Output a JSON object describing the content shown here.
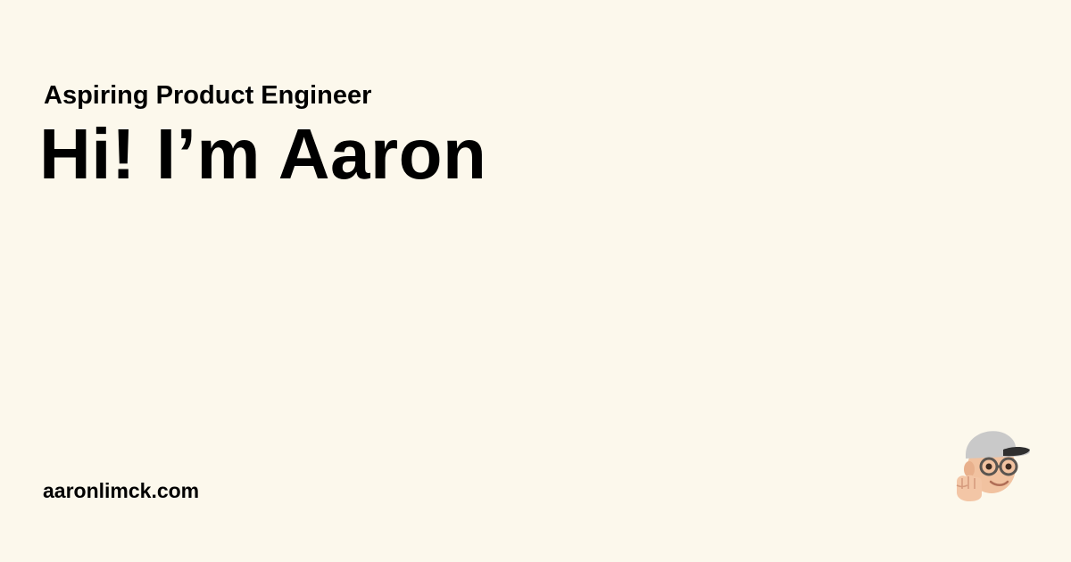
{
  "card": {
    "subtitle": "Aspiring Product Engineer",
    "headline": "Hi! I’m Aaron",
    "site": "aaronlimck.com",
    "avatar_icon": "memoji-avatar-icon"
  },
  "colors": {
    "background": "#fcf8ec",
    "text": "#000000",
    "cap": "#c8c8c8",
    "skin": "#f1c2a0"
  }
}
